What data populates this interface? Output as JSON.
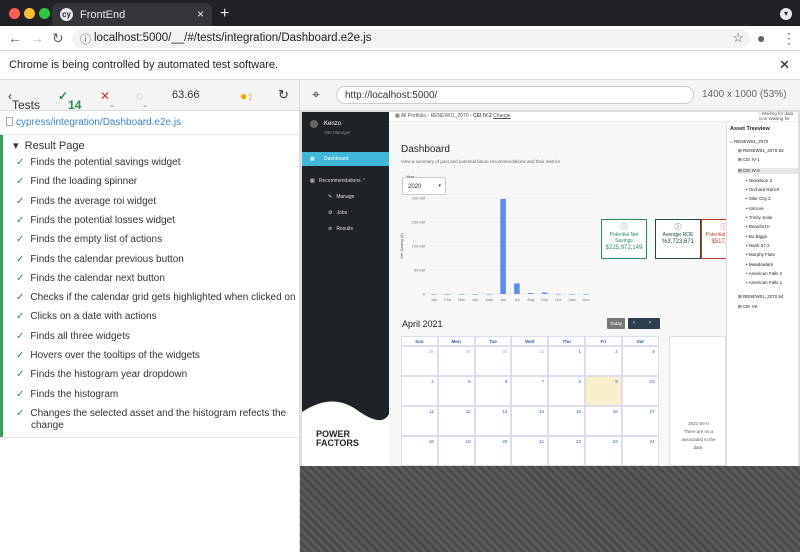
{
  "browser": {
    "tab_title": "FrontEnd",
    "url": "localhost:5000/__/#/tests/integration/Dashboard.e2e.js",
    "infobar": "Chrome is being controlled by automated test software."
  },
  "cypress": {
    "back_label": "Tests",
    "passed": "14",
    "failed": "--",
    "pending": "--",
    "duration": "63.66",
    "spec": "cypress/integration/Dashboard.e2e.js",
    "suite": "Result Page",
    "tests": [
      "Finds the potential savings widget",
      "Find the loading spinner",
      "Finds the average roi widget",
      "Finds the potential losses widget",
      "Finds the empty list of actions",
      "Finds the calendar previous button",
      "Finds the calendar next button",
      "Checks if the calendar grid gets highlighted when clicked on",
      "Clicks on a date with actions",
      "Finds all three widgets",
      "Hovers over the tooltips of the widgets",
      "Finds the histogram year dropdown",
      "Finds the histogram",
      "Changes the selected asset and the histogram refects the",
      "change"
    ],
    "app_url": "http://localhost:5000/",
    "viewport": "1400 x 1000",
    "scale": "(53%)"
  },
  "app": {
    "user": "Kenzo",
    "role": "Site Manager",
    "nav": [
      "Dashboard",
      "Recommendations",
      "Manage",
      "Jobs",
      "Results"
    ],
    "brand": [
      "POWER",
      "FACTORS"
    ],
    "breadcrumb": [
      "All Portfolio",
      "RENEW01_2070",
      "CEI IV-2",
      "Change"
    ],
    "title": "Dashboard",
    "subtitle": "View a summary of past and potential future recommendations and their metrics",
    "year_label": "Year",
    "year": "2020",
    "ylabel": "Net Saving ($)",
    "widgets": [
      {
        "title": "Potential Net Savings",
        "value": "$225,972,149"
      },
      {
        "title": "Average ROE",
        "value": "%3,723,671"
      },
      {
        "title": "Potential Losses",
        "value": "$517,471"
      }
    ],
    "calendar": {
      "title": "April 2021",
      "today": "Today",
      "days": [
        "Sun",
        "Mon",
        "Tue",
        "Wed",
        "Thu",
        "Fri",
        "Sat"
      ],
      "weeks": [
        [
          "28",
          "29",
          "30",
          "31",
          "1",
          "2",
          "3"
        ],
        [
          "4",
          "5",
          "6",
          "7",
          "8",
          "9",
          "10"
        ],
        [
          "11",
          "12",
          "13",
          "14",
          "15",
          "16",
          "17"
        ],
        [
          "18",
          "19",
          "20",
          "21",
          "22",
          "23",
          "24"
        ]
      ]
    },
    "empty": {
      "date": "2021-04-0",
      "text": "There are no a",
      "text2": "associated to the",
      "text3": "date."
    },
    "tree": {
      "title": "Asset Treeview",
      "waiting": "Waiting for data",
      "icon": "icon",
      "items": [
        "RENEW01_2070",
        "RENEW01_2070.93",
        "CEI IV-1",
        "CEI IV-2",
        "Nickelson 2",
        "Orchard Ranch",
        "Siler City 2",
        "Simcoe",
        "Trinity Solar",
        "Beaufort II",
        "Bo Biggs",
        "Nash 57-2",
        "Murphy Flats",
        "Meadowlark",
        "American Falls 2",
        "American Falls 1",
        "RENEW01_2070.94",
        "CEI VII"
      ]
    }
  },
  "chart_data": {
    "type": "bar",
    "categories": [
      "Jan",
      "Feb",
      "Mar",
      "Apr",
      "May",
      "Jun",
      "Jul",
      "Aug",
      "Sep",
      "Oct",
      "Nov",
      "Dec"
    ],
    "values": [
      0,
      0,
      0,
      0,
      0,
      198000000,
      22000000,
      2000000,
      3000000,
      0,
      0,
      0
    ],
    "ylabel": "Net Saving ($)",
    "yticks": [
      "0",
      "50.0M",
      "100.0M",
      "150.0M",
      "200.0M"
    ],
    "ylim": [
      0,
      200000000
    ],
    "color": "#5b8ee6"
  }
}
